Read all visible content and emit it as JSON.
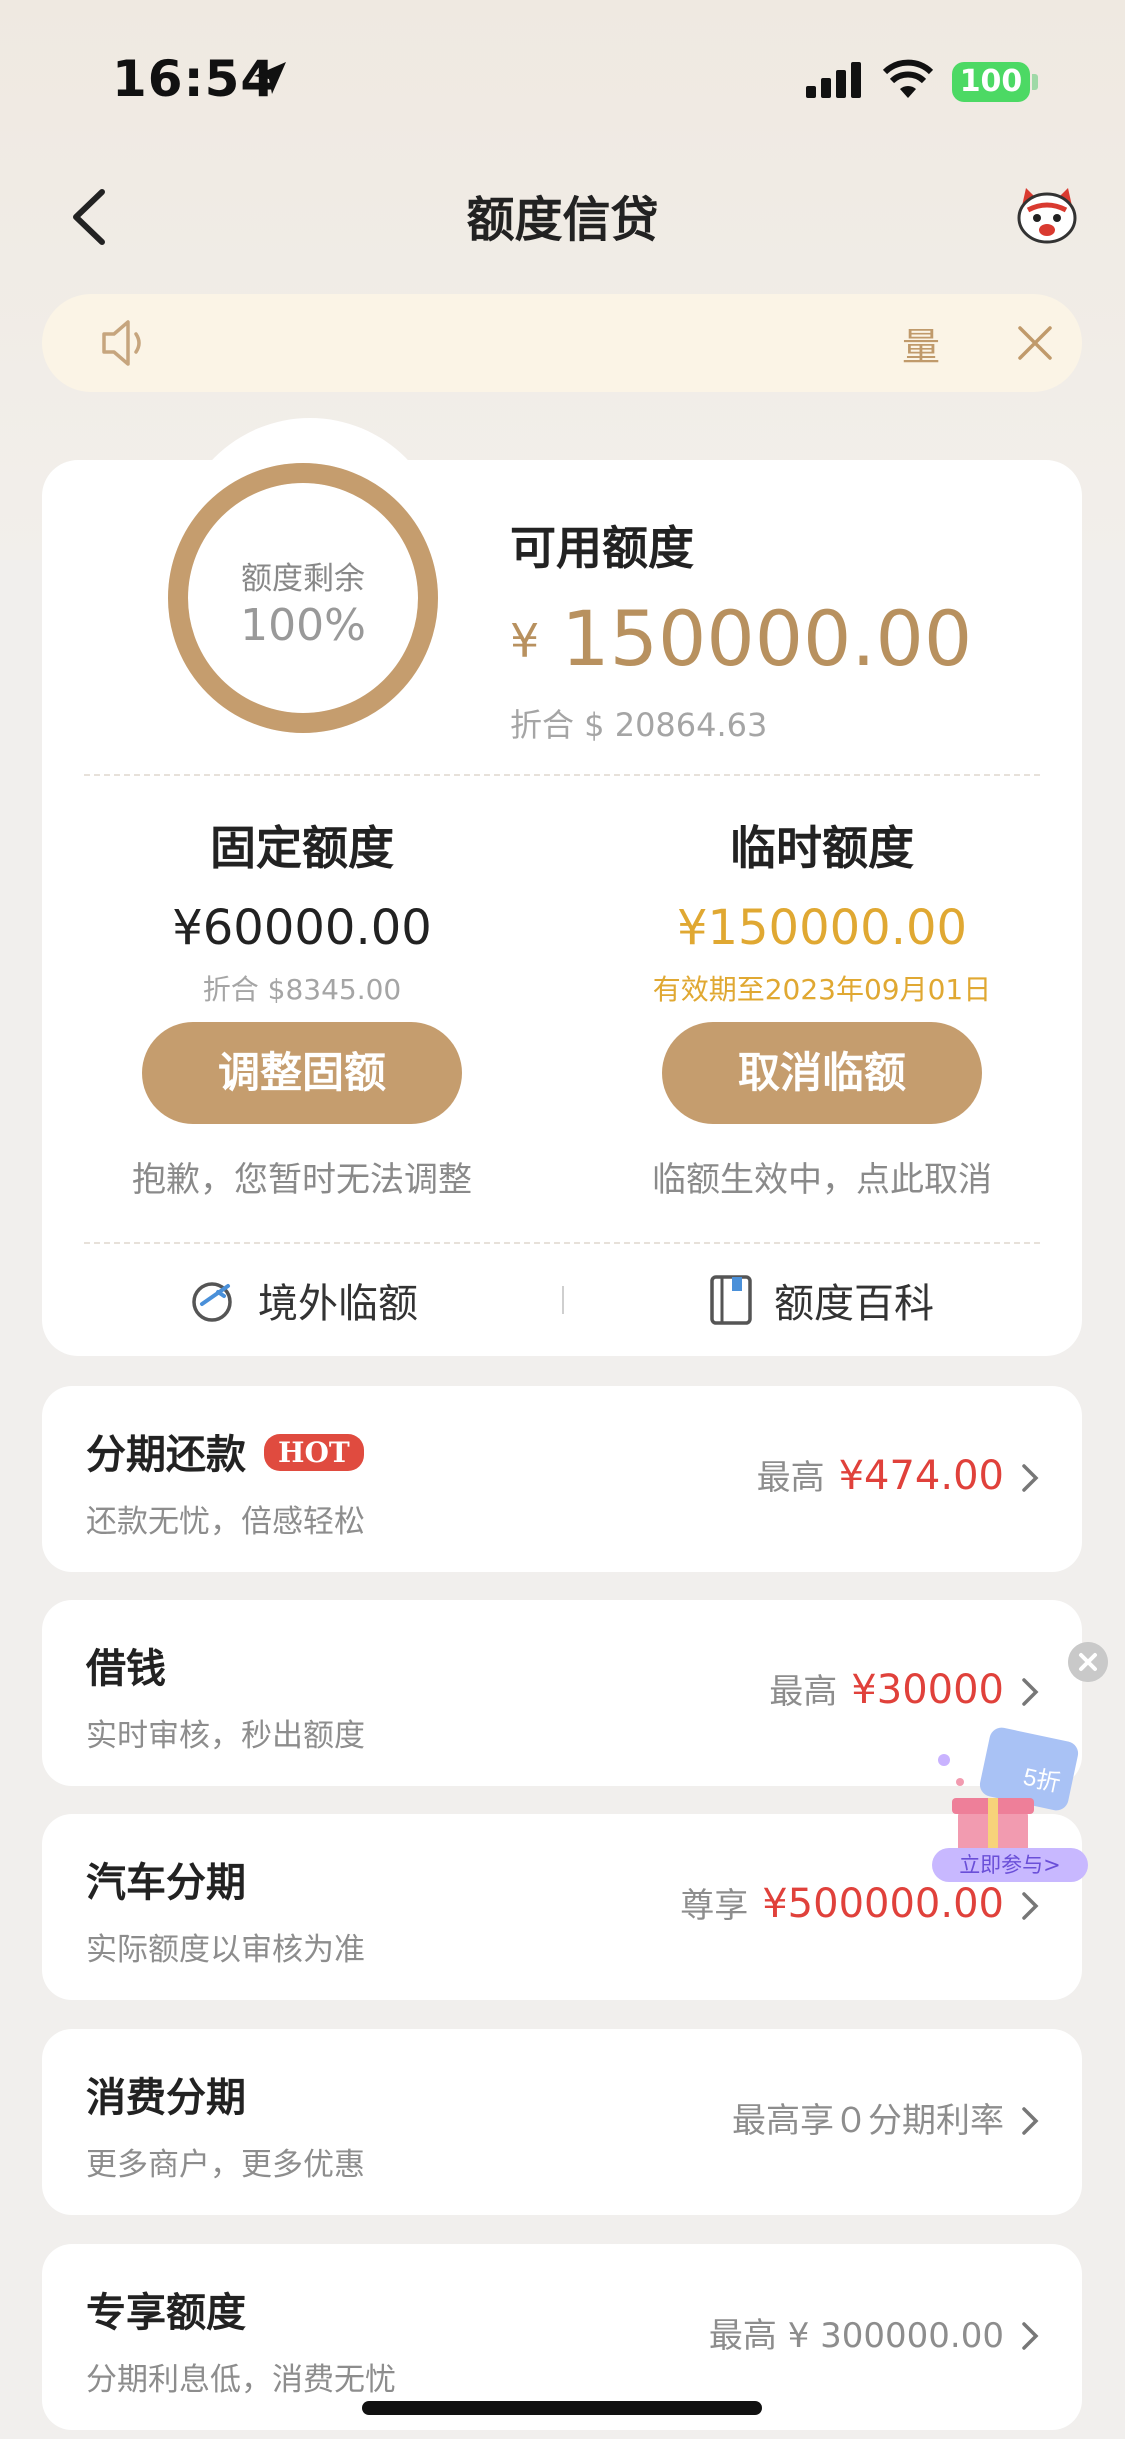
{
  "status_bar": {
    "time": "16:54",
    "battery": "100"
  },
  "header": {
    "title": "额度信贷"
  },
  "notice": {
    "text": "量"
  },
  "credit": {
    "ring_label": "额度剩余",
    "ring_value": "100%",
    "ring_percent": 100,
    "available_label": "可用额度",
    "available_currency": "¥",
    "available_amount": "150000.00",
    "available_converted": "折合 $ 20864.63",
    "fixed": {
      "title": "固定额度",
      "amount": "¥60000.00",
      "sub": "折合 $8345.00",
      "button": "调整固额",
      "tip": "抱歉，您暂时无法调整"
    },
    "temporary": {
      "title": "临时额度",
      "amount": "¥150000.00",
      "sub": "有效期至2023年09月01日",
      "button": "取消临额",
      "tip": "临额生效中，点此取消"
    },
    "shortcuts": [
      {
        "label": "境外临额",
        "icon": "plane-globe-icon"
      },
      {
        "label": "额度百科",
        "icon": "book-icon"
      }
    ]
  },
  "services": [
    {
      "title": "分期还款",
      "badge": "HOT",
      "sub": "还款无忧，倍感轻松",
      "prefix": "最高",
      "amount": "¥474.00"
    },
    {
      "title": "借钱",
      "sub": "实时审核，秒出额度",
      "prefix": "最高",
      "amount": "¥30000"
    },
    {
      "title": "汽车分期",
      "sub": "实际额度以审核为准",
      "prefix": "尊享",
      "amount": "¥500000.00"
    },
    {
      "title": "消费分期",
      "sub": "更多商户，更多优惠",
      "prefix": "最高享０分期利率",
      "amount": ""
    },
    {
      "title": "专享额度",
      "sub": "分期利息低，消费无忧",
      "prefix": "最高 ¥ 300000.00",
      "amount": ""
    }
  ],
  "promo": {
    "discount": "5折",
    "cta": "立即参与>"
  },
  "colors": {
    "gold": "#c59d6e",
    "temp_amount": "#e0a832",
    "red": "#e0413b"
  }
}
